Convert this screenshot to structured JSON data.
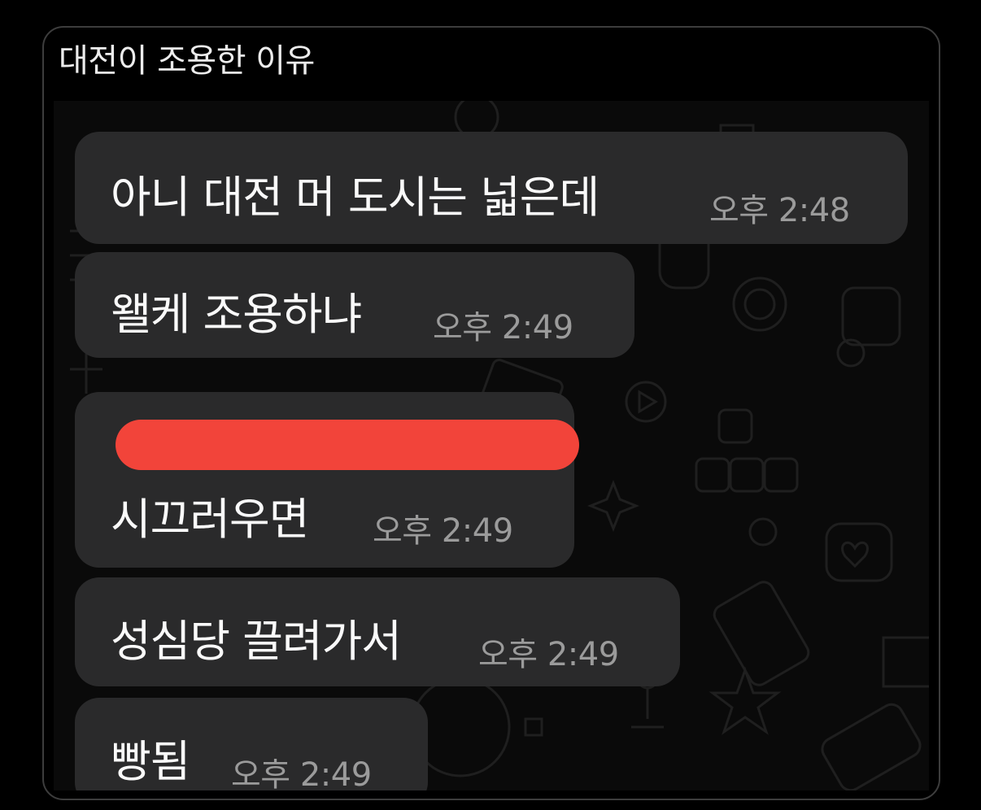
{
  "post": {
    "title": "대전이 조용한 이유"
  },
  "colors": {
    "background": "#000000",
    "bubble": "#2a2a2b",
    "message_text": "#fafafa",
    "time_text": "#9b9b9b",
    "redaction": "#f2443a"
  },
  "chat": {
    "messages": [
      {
        "text": "아니 대전 머 도시는 넓은데",
        "time": "오후 2:48"
      },
      {
        "text": "왤케 조용하냐",
        "time": "오후 2:49"
      },
      {
        "text": "시끄러우면",
        "time": "오후 2:49",
        "redacted_line": true
      },
      {
        "text": "성심당 끌려가서",
        "time": "오후 2:49"
      },
      {
        "text": "빵됨",
        "time": "오후 2:49"
      }
    ]
  }
}
